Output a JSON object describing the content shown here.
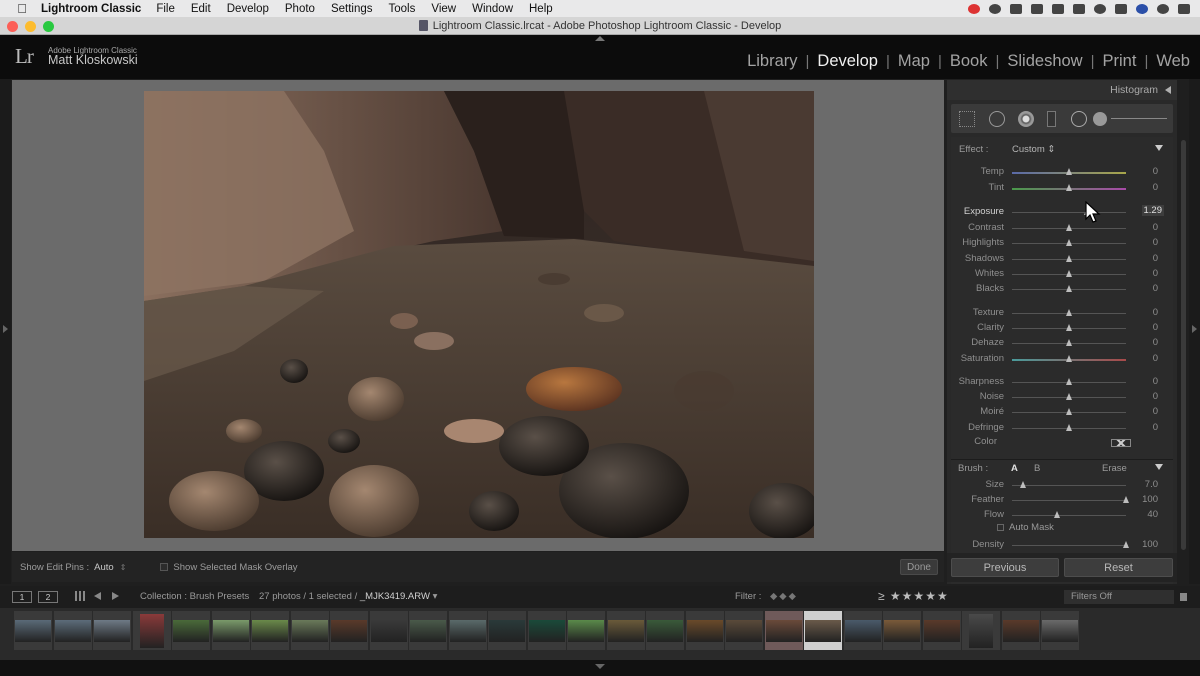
{
  "menubar": {
    "app_name": "Lightroom Classic",
    "items": [
      "File",
      "Edit",
      "Develop",
      "Photo",
      "Settings",
      "Tools",
      "View",
      "Window",
      "Help"
    ]
  },
  "window": {
    "title": "Lightroom Classic.lrcat - Adobe Photoshop Lightroom Classic - Develop"
  },
  "identity": {
    "logo": "Lr",
    "subtitle": "Adobe Lightroom Classic",
    "name": "Matt Kloskowski"
  },
  "modules": [
    {
      "label": "Library",
      "active": false
    },
    {
      "label": "Develop",
      "active": true
    },
    {
      "label": "Map",
      "active": false
    },
    {
      "label": "Book",
      "active": false
    },
    {
      "label": "Slideshow",
      "active": false
    },
    {
      "label": "Print",
      "active": false
    },
    {
      "label": "Web",
      "active": false
    }
  ],
  "toolbar": {
    "show_edit_pins_label": "Show Edit Pins :",
    "show_edit_pins_value": "Auto",
    "show_mask_overlay_label": "Show Selected Mask Overlay",
    "done_label": "Done"
  },
  "panel": {
    "histogram_label": "Histogram",
    "effect_label": "Effect :",
    "effect_value": "Custom",
    "color_label": "Color",
    "sliders": [
      {
        "label": "Temp",
        "value": "0",
        "pos": 0.5
      },
      {
        "label": "Tint",
        "value": "0",
        "pos": 0.5
      },
      {
        "label": "Exposure",
        "value": "1.29",
        "pos": 0.66,
        "active": true
      },
      {
        "label": "Contrast",
        "value": "0",
        "pos": 0.5
      },
      {
        "label": "Highlights",
        "value": "0",
        "pos": 0.5
      },
      {
        "label": "Shadows",
        "value": "0",
        "pos": 0.5
      },
      {
        "label": "Whites",
        "value": "0",
        "pos": 0.5
      },
      {
        "label": "Blacks",
        "value": "0",
        "pos": 0.5
      },
      {
        "label": "Texture",
        "value": "0",
        "pos": 0.5
      },
      {
        "label": "Clarity",
        "value": "0",
        "pos": 0.5
      },
      {
        "label": "Dehaze",
        "value": "0",
        "pos": 0.5
      },
      {
        "label": "Saturation",
        "value": "0",
        "pos": 0.5
      },
      {
        "label": "Sharpness",
        "value": "0",
        "pos": 0.5
      },
      {
        "label": "Noise",
        "value": "0",
        "pos": 0.5
      },
      {
        "label": "Moiré",
        "value": "0",
        "pos": 0.5
      },
      {
        "label": "Defringe",
        "value": "0",
        "pos": 0.5
      }
    ],
    "brush": {
      "label": "Brush :",
      "a_label": "A",
      "b_label": "B",
      "erase_label": "Erase",
      "sliders": [
        {
          "label": "Size",
          "value": "7.0",
          "pos": 0.1
        },
        {
          "label": "Feather",
          "value": "100",
          "pos": 1.0
        },
        {
          "label": "Flow",
          "value": "40",
          "pos": 0.4
        },
        {
          "label": "Density",
          "value": "100",
          "pos": 1.0
        }
      ],
      "auto_mask_label": "Auto Mask"
    },
    "previous_label": "Previous",
    "reset_label": "Reset"
  },
  "filmstrip_bar": {
    "view1": "1",
    "view2": "2",
    "collection": "Collection : Brush Presets",
    "count": "27 photos / 1 selected /",
    "filename": "_MJK3419.ARW",
    "filter_label": "Filter :",
    "filters_off": "Filters Off"
  },
  "filmstrip": {
    "thumbs": [
      "#5a6a78",
      "#5c6c7a",
      "#6e7a86",
      "#8a3a3a",
      "#4a6a3a",
      "#7a9a6a",
      "#6a8a4a",
      "#6a7a5a",
      "#5a3a2a",
      "#3a3a3a",
      "#4a5a4a",
      "#5a6a6a",
      "#2a3a3a",
      "#1a4a3a",
      "#5a8a4a",
      "#6a5a3a",
      "#3a5a3a",
      "#6a4a2a",
      "#5a4a3a",
      "#6a4a3a",
      "#6a5a4a",
      "#4a5a6a",
      "#7a5a3a",
      "#5a3a2a",
      "#4a4a4a",
      "#5a3a2a",
      "#6a6a6a"
    ],
    "selected_index": 20,
    "portrait_indices": [
      3,
      24
    ],
    "pink_index": 19
  },
  "colors": {
    "accent": "#ffffff"
  }
}
